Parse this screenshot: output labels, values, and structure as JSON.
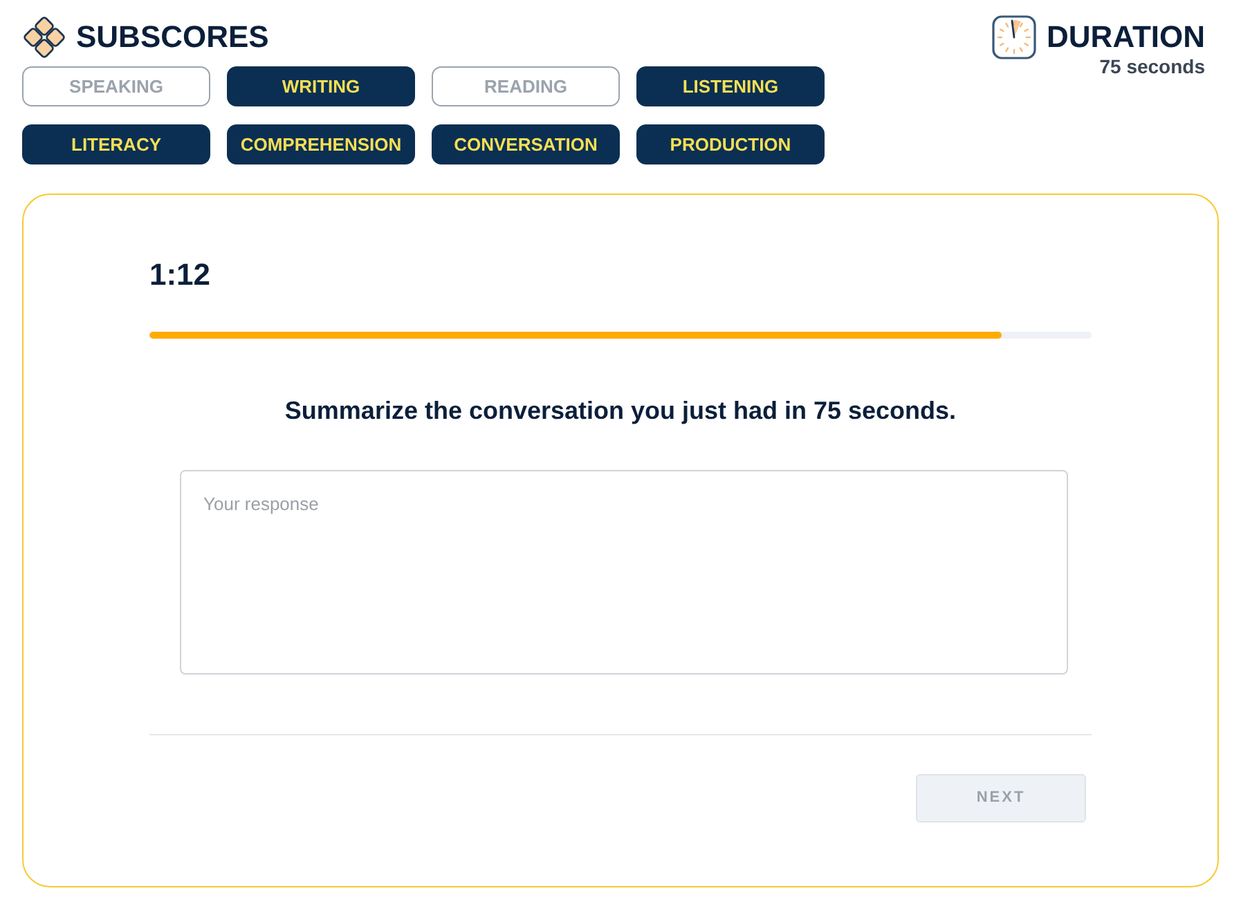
{
  "header": {
    "title": "SUBSCORES",
    "duration_label": "DURATION",
    "duration_value": "75 seconds"
  },
  "subscores": [
    {
      "label": "SPEAKING",
      "active": false
    },
    {
      "label": "WRITING",
      "active": true
    },
    {
      "label": "READING",
      "active": false
    },
    {
      "label": "LISTENING",
      "active": true
    },
    {
      "label": "LITERACY",
      "active": true
    },
    {
      "label": "COMPREHENSION",
      "active": true
    },
    {
      "label": "CONVERSATION",
      "active": true
    },
    {
      "label": "PRODUCTION",
      "active": true
    }
  ],
  "task": {
    "timer": "1:12",
    "progress": {
      "level": 0.905
    },
    "prompt": "Summarize the conversation you just had in 75 seconds.",
    "response": {
      "placeholder": "Your response"
    },
    "next_button": {
      "label": "NEXT",
      "disabled": true
    }
  }
}
